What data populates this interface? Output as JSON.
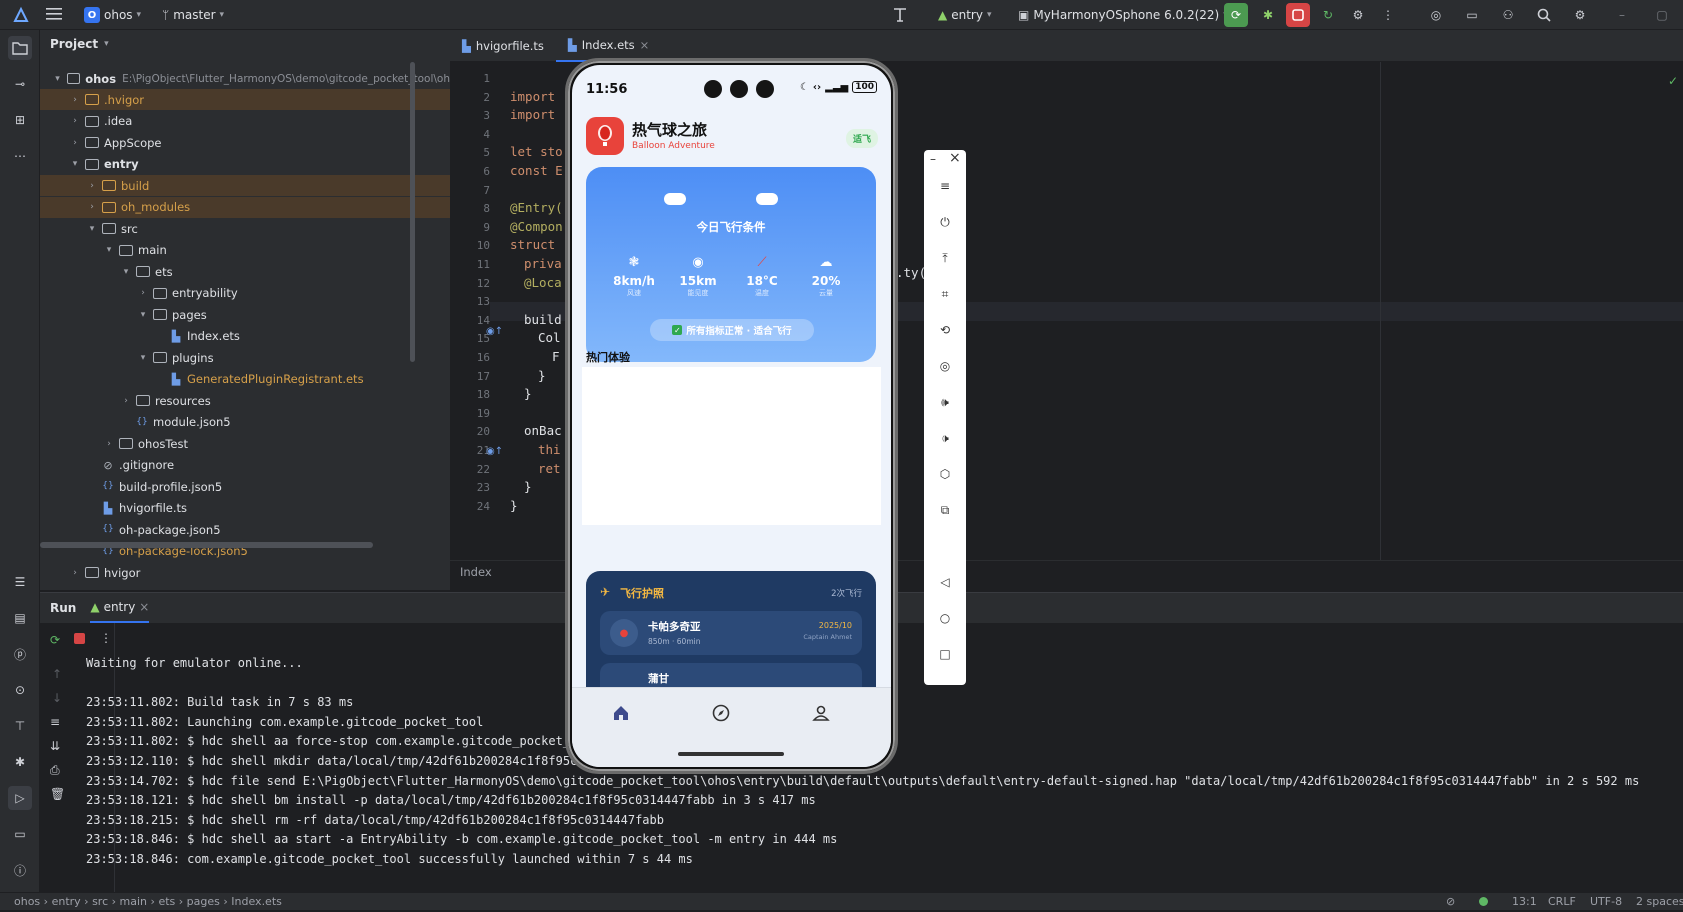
{
  "topbar": {
    "project_badge": "O",
    "project_name": "ohos",
    "branch": "master",
    "run_config": "entry",
    "device": "MyHarmonyOSphone 6.0.2(22)"
  },
  "project_panel": {
    "title": "Project",
    "root_name": "ohos",
    "root_path": "E:\\PigObject\\Flutter_HarmonyOS\\demo\\gitcode_pocket_tool\\oh",
    "items": [
      {
        "label": ".hvigor",
        "level": 1,
        "type": "folder",
        "expanded": false,
        "color": "orange",
        "highlight": true
      },
      {
        "label": ".idea",
        "level": 1,
        "type": "folder",
        "expanded": false,
        "color": "normal",
        "highlight": false
      },
      {
        "label": "AppScope",
        "level": 1,
        "type": "folder",
        "expanded": false,
        "color": "normal",
        "highlight": false
      },
      {
        "label": "entry",
        "level": 1,
        "type": "folder",
        "expanded": true,
        "color": "bold",
        "highlight": false
      },
      {
        "label": "build",
        "level": 2,
        "type": "folder",
        "expanded": false,
        "color": "orange",
        "highlight": true
      },
      {
        "label": "oh_modules",
        "level": 2,
        "type": "folder",
        "expanded": false,
        "color": "orange",
        "highlight": true
      },
      {
        "label": "src",
        "level": 2,
        "type": "folder",
        "expanded": true,
        "color": "normal",
        "highlight": false
      },
      {
        "label": "main",
        "level": 3,
        "type": "folder",
        "expanded": true,
        "color": "normal",
        "highlight": false
      },
      {
        "label": "ets",
        "level": 4,
        "type": "folder",
        "expanded": true,
        "color": "normal",
        "highlight": false
      },
      {
        "label": "entryability",
        "level": 5,
        "type": "folder",
        "expanded": false,
        "color": "normal",
        "highlight": false
      },
      {
        "label": "pages",
        "level": 5,
        "type": "folder",
        "expanded": true,
        "color": "normal",
        "highlight": false
      },
      {
        "label": "Index.ets",
        "level": 6,
        "type": "file",
        "expanded": null,
        "color": "normal",
        "highlight": false
      },
      {
        "label": "plugins",
        "level": 5,
        "type": "folder",
        "expanded": true,
        "color": "normal",
        "highlight": false
      },
      {
        "label": "GeneratedPluginRegistrant.ets",
        "level": 6,
        "type": "file",
        "expanded": null,
        "color": "orange",
        "highlight": false
      },
      {
        "label": "resources",
        "level": 4,
        "type": "folder",
        "expanded": false,
        "color": "normal",
        "highlight": false
      },
      {
        "label": "module.json5",
        "level": 4,
        "type": "json",
        "expanded": null,
        "color": "normal",
        "highlight": false
      },
      {
        "label": "ohosTest",
        "level": 3,
        "type": "folder",
        "expanded": false,
        "color": "normal",
        "highlight": false
      },
      {
        "label": ".gitignore",
        "level": 2,
        "type": "ignore",
        "expanded": null,
        "color": "normal",
        "highlight": false
      },
      {
        "label": "build-profile.json5",
        "level": 2,
        "type": "json",
        "expanded": null,
        "color": "normal",
        "highlight": false
      },
      {
        "label": "hvigorfile.ts",
        "level": 2,
        "type": "file",
        "expanded": null,
        "color": "normal",
        "highlight": false
      },
      {
        "label": "oh-package.json5",
        "level": 2,
        "type": "json",
        "expanded": null,
        "color": "normal",
        "highlight": false
      },
      {
        "label": "oh-package-lock.json5",
        "level": 2,
        "type": "json",
        "expanded": null,
        "color": "orange",
        "highlight": false
      },
      {
        "label": "hvigor",
        "level": 1,
        "type": "folder",
        "expanded": false,
        "color": "normal",
        "highlight": false
      }
    ]
  },
  "editor": {
    "tabs": [
      {
        "label": "hvigorfile.ts",
        "active": false
      },
      {
        "label": "Index.ets",
        "active": true
      }
    ],
    "footer": "Index",
    "line_numbers": [
      "1",
      "2",
      "3",
      "4",
      "5",
      "6",
      "7",
      "8",
      "9",
      "10",
      "11",
      "12",
      "13",
      "14",
      "15",
      "16",
      "17",
      "18",
      "19",
      "20",
      "21",
      "22",
      "23",
      "24"
    ],
    "code_lines": [
      {
        "ln": 2,
        "indent": 0,
        "text": "import",
        "kind": "kw"
      },
      {
        "ln": 3,
        "indent": 0,
        "text": "import",
        "kind": "kw"
      },
      {
        "ln": 5,
        "indent": 0,
        "text": "let sto",
        "kind": "kw"
      },
      {
        "ln": 6,
        "indent": 0,
        "text": "const E",
        "kind": "kw"
      },
      {
        "ln": 8,
        "indent": 0,
        "text": "@Entry(",
        "kind": "dec"
      },
      {
        "ln": 9,
        "indent": 0,
        "text": "@Compon",
        "kind": "dec"
      },
      {
        "ln": 10,
        "indent": 0,
        "text": "struct ",
        "kind": "kw"
      },
      {
        "ln": 11,
        "indent": 1,
        "text": "priva",
        "kind": "kw"
      },
      {
        "ln": 12,
        "indent": 1,
        "text": "@Loca",
        "kind": "dec"
      },
      {
        "ln": 14,
        "indent": 1,
        "text": "build",
        "kind": "plain"
      },
      {
        "ln": 15,
        "indent": 2,
        "text": "Col",
        "kind": "plain"
      },
      {
        "ln": 16,
        "indent": 3,
        "text": "F",
        "kind": "plain"
      },
      {
        "ln": 17,
        "indent": 2,
        "text": "}",
        "kind": "plain"
      },
      {
        "ln": 18,
        "indent": 1,
        "text": "}",
        "kind": "plain"
      },
      {
        "ln": 20,
        "indent": 1,
        "text": "onBac",
        "kind": "plain"
      },
      {
        "ln": 21,
        "indent": 2,
        "text": "thi",
        "kind": "kw"
      },
      {
        "ln": 22,
        "indent": 2,
        "text": "ret",
        "kind": "kw"
      },
      {
        "ln": 23,
        "indent": 1,
        "text": "}",
        "kind": "plain"
      },
      {
        "ln": 24,
        "indent": 0,
        "text": "}",
        "kind": "plain"
      }
    ],
    "right_fragment": ".ty("
  },
  "run_panel": {
    "tab_run": "Run",
    "tab_entry": "entry",
    "console": [
      "Waiting for emulator online...",
      "",
      "23:53:11.802: Build task in 7 s 83 ms",
      "23:53:11.802: Launching com.example.gitcode_pocket_tool",
      "23:53:11.802: $ hdc shell aa force-stop com.example.gitcode_pocket_",
      "23:53:12.110: $ hdc shell mkdir data/local/tmp/42df61b200284c1f8f95c",
      "23:53:14.702: $ hdc file send E:\\PigObject\\Flutter_HarmonyOS\\demo\\gitcode_pocket_tool\\ohos\\entry\\build\\default\\outputs\\default\\entry-default-signed.hap \"data/local/tmp/42df61b200284c1f8f95c0314447fabb\" in 2 s 592 ms",
      "23:53:18.121: $ hdc shell bm install -p data/local/tmp/42df61b200284c1f8f95c0314447fabb in 3 s 417 ms",
      "23:53:18.215: $ hdc shell rm -rf data/local/tmp/42df61b200284c1f8f95c0314447fabb",
      "23:53:18.846: $ hdc shell aa start -a EntryAbility -b com.example.gitcode_pocket_tool -m entry in 444 ms",
      "23:53:18.846: com.example.gitcode_pocket_tool successfully launched within 7 s 44 ms"
    ]
  },
  "statusbar": {
    "breadcrumb": [
      "ohos",
      "entry",
      "src",
      "main",
      "ets",
      "pages",
      "Index.ets"
    ],
    "position": "13:1",
    "line_sep": "CRLF",
    "encoding": "UTF-8",
    "indent": "2 spaces"
  },
  "phone": {
    "time": "11:56",
    "battery": "100",
    "app_title": "热气球之旅",
    "app_subtitle": "Balloon Adventure",
    "badge": "适飞",
    "weather_title": "今日飞行条件",
    "metrics": [
      {
        "value": "8km/h",
        "label": "风速",
        "icon": "wind-icon"
      },
      {
        "value": "15km",
        "label": "能见度",
        "icon": "eye-icon"
      },
      {
        "value": "18°C",
        "label": "温度",
        "icon": "thermometer-icon"
      },
      {
        "value": "20%",
        "label": "云量",
        "icon": "cloud-icon"
      }
    ],
    "status_pill": "所有指标正常 · 适合飞行",
    "section_title": "热门体验",
    "passport_title": "飞行护照",
    "passport_count": "2次飞行",
    "flight1_name": "卡帕多奇亚",
    "flight1_meta": "850m · 60min",
    "flight1_date": "2025/10",
    "flight1_pilot": "Captain Ahmet",
    "flight2_name": "蒲甘"
  },
  "colors": {
    "accent": "#3574f0",
    "app_red": "#e8433b",
    "weather_top": "#4d8ef5",
    "passport_bg": "#1f3a63",
    "badge_green": "#2fa84f"
  }
}
